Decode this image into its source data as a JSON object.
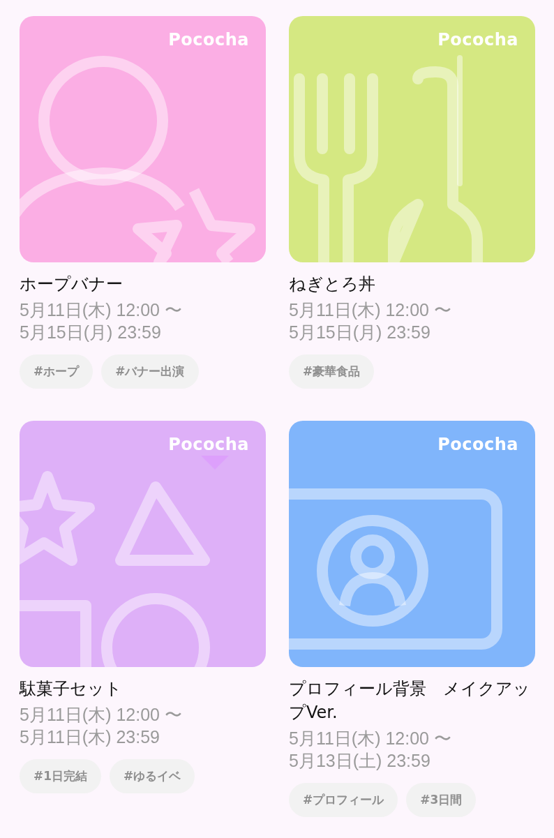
{
  "cards": [
    {
      "kind": "person-star",
      "color": "#fbaee4",
      "logo": "Pococha",
      "title": "ホープバナー",
      "dates": [
        "5月11日(木) 12:00 〜",
        "5月15日(月) 23:59"
      ],
      "tags": [
        "#ホープ",
        "#バナー出演"
      ]
    },
    {
      "kind": "cutlery",
      "color": "#d5e882",
      "logo": "Pococha",
      "title": "ねぎとろ丼",
      "dates": [
        "5月11日(木) 12:00 〜",
        "5月15日(月) 23:59"
      ],
      "tags": [
        "#豪華食品"
      ]
    },
    {
      "kind": "shapes",
      "color": "#deb0f8",
      "logo": "Pococha",
      "title": "駄菓子セット",
      "dates": [
        "5月11日(木) 12:00 〜",
        "5月11日(木) 23:59"
      ],
      "tags": [
        "#1日完結",
        "#ゆるイベ"
      ]
    },
    {
      "kind": "profile",
      "color": "#80b5fb",
      "logo": "Pococha",
      "title": "プロフィール背景　メイクアップVer.",
      "dates": [
        "5月11日(木) 12:00 〜",
        "5月13日(土) 23:59"
      ],
      "tags": [
        "#プロフィール",
        "#3日間"
      ]
    }
  ]
}
